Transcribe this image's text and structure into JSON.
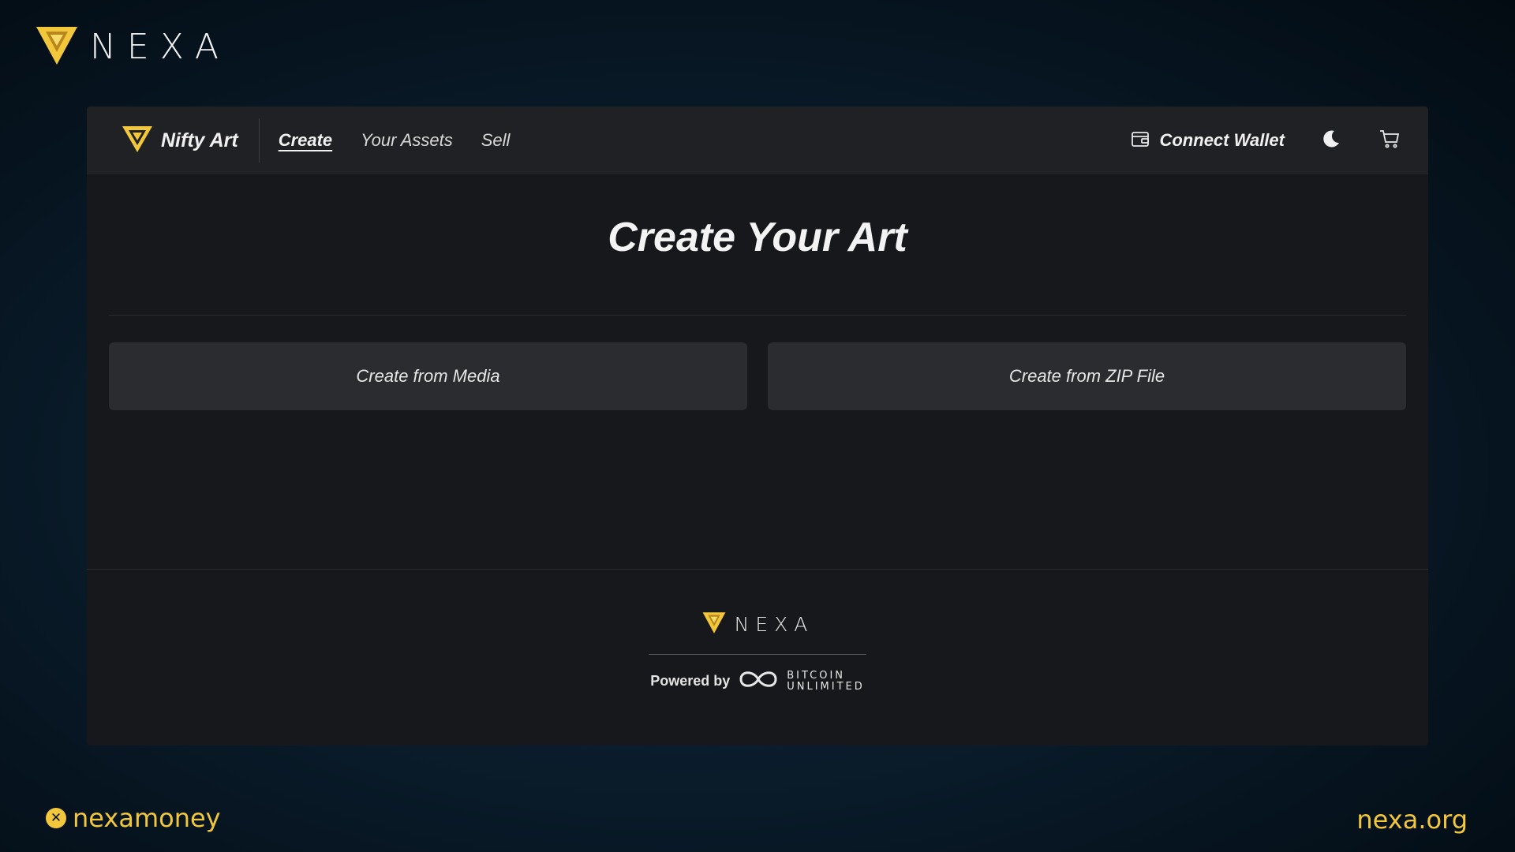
{
  "brand": {
    "wordmark": "NEXA"
  },
  "navbar": {
    "app_name": "Nifty Art",
    "links": [
      {
        "label": "Create",
        "active": true
      },
      {
        "label": "Your Assets",
        "active": false
      },
      {
        "label": "Sell",
        "active": false
      }
    ],
    "connect_wallet": "Connect Wallet"
  },
  "main": {
    "title": "Create Your Art",
    "actions": [
      {
        "label": "Create from Media"
      },
      {
        "label": "Create from ZIP File"
      }
    ]
  },
  "footer": {
    "wordmark": "NEXA",
    "powered_by": "Powered by",
    "partner_line1": "BITCOIN",
    "partner_line2": "UNLIMITED"
  },
  "socials": {
    "x_handle": "nexamoney",
    "website": "nexa.org"
  },
  "colors": {
    "accent_gold": "#f3c73b",
    "app_bg": "#16181b",
    "navbar_bg": "#1f2124",
    "button_bg": "#2a2c2f"
  }
}
